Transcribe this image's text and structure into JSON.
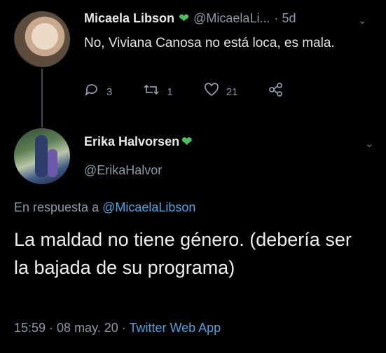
{
  "tweet": {
    "author_name": "Micaela Libson",
    "author_handle": "@MicaelaLi...",
    "time_ago": "· 5d",
    "text": "No, Viviana Canosa no está loca, es mala.",
    "actions": {
      "replies": "3",
      "retweets": "1",
      "likes": "21"
    }
  },
  "reply": {
    "author_name": "Erika Halvorsen",
    "author_handle": "@ErikaHalvor",
    "reply_prefix": "En respuesta a",
    "reply_to": "@MicaelaLibson",
    "text": "La maldad no tiene género. (debería ser la bajada de su programa)",
    "timestamp": "15:59 · 08 may. 20 ·",
    "source": "Twitter Web App"
  },
  "icons": {
    "verified_heart": "green-heart-icon",
    "reply": "reply-icon",
    "retweet": "retweet-icon",
    "like": "heart-outline-icon",
    "share": "share-icon",
    "more": "chevron-down-icon"
  },
  "colors": {
    "background": "#000000",
    "link": "#4aa3df",
    "muted": "#8b98a5",
    "heart": "#4bbf62"
  }
}
